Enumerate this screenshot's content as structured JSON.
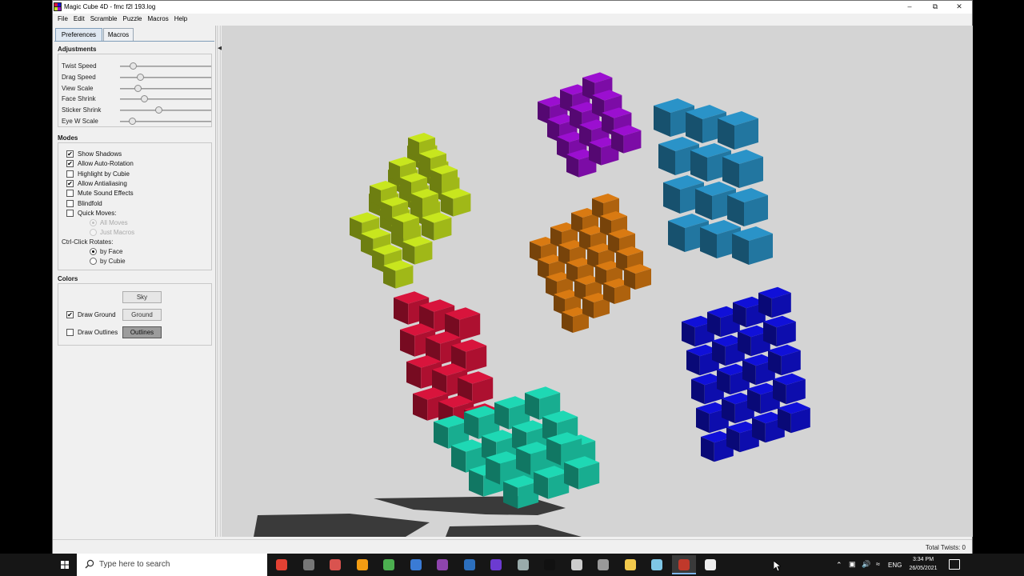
{
  "window": {
    "title": "Magic Cube 4D - fmc f2l 193.log",
    "controls": {
      "minimize": "–",
      "maximize": "⧉",
      "close": "✕"
    }
  },
  "menu": [
    "File",
    "Edit",
    "Scramble",
    "Puzzle",
    "Macros",
    "Help"
  ],
  "tabs": [
    {
      "label": "Preferences",
      "active": true
    },
    {
      "label": "Macros",
      "active": false
    }
  ],
  "adjustments": {
    "title": "Adjustments",
    "sliders": [
      {
        "label": "Twist Speed",
        "fraction": 0.14
      },
      {
        "label": "Drag Speed",
        "fraction": 0.22
      },
      {
        "label": "View Scale",
        "fraction": 0.19
      },
      {
        "label": "Face Shrink",
        "fraction": 0.26
      },
      {
        "label": "Sticker Shrink",
        "fraction": 0.42
      },
      {
        "label": "Eye W Scale",
        "fraction": 0.13
      }
    ]
  },
  "modes": {
    "title": "Modes",
    "checkboxes": [
      {
        "label": "Show Shadows",
        "checked": true
      },
      {
        "label": "Allow Auto-Rotation",
        "checked": true
      },
      {
        "label": "Highlight by Cubie",
        "checked": false
      },
      {
        "label": "Allow Antialiasing",
        "checked": true
      },
      {
        "label": "Mute Sound Effects",
        "checked": false
      },
      {
        "label": "Blindfold",
        "checked": false
      },
      {
        "label": "Quick Moves:",
        "checked": false
      }
    ],
    "quick_moves": [
      {
        "label": "All Moves",
        "selected": true
      },
      {
        "label": "Just Macros",
        "selected": false
      }
    ],
    "ctrl_click_label": "Ctrl-Click Rotates:",
    "ctrl_click": [
      {
        "label": "by Face",
        "selected": true
      },
      {
        "label": "by Cubie",
        "selected": false
      }
    ]
  },
  "colors": {
    "title": "Colors",
    "sky_button": "Sky",
    "ground_checkbox": {
      "label": "Draw Ground",
      "checked": true
    },
    "ground_button": "Ground",
    "outlines_checkbox": {
      "label": "Draw Outlines",
      "checked": false
    },
    "outlines_button": "Outlines"
  },
  "status": {
    "total_twists": "Total Twists: 0"
  },
  "viewport": {
    "background": "#d4d4d4",
    "face_colors": {
      "yellow": "#c8e61e",
      "purple": "#9b0fd0",
      "cyan": "#2a93c8",
      "orange": "#d97a12",
      "red": "#d8143c",
      "teal": "#1ed8b4",
      "blue": "#1010d8"
    }
  },
  "taskbar": {
    "search_placeholder": "Type here to search",
    "apps": [
      "chrome-icon",
      "obs-icon",
      "camera-icon",
      "vlc-icon",
      "minecraft-icon",
      "vscode-icon",
      "puzzle-icon",
      "globe-icon",
      "app-icon",
      "game-icon",
      "terminal-icon",
      "settings-icon",
      "files-icon",
      "folder-icon",
      "notes-icon",
      "magic-cube-icon",
      "unity-icon"
    ],
    "tray_language": "ENG",
    "time": "3:34 PM",
    "date": "26/05/2021"
  }
}
